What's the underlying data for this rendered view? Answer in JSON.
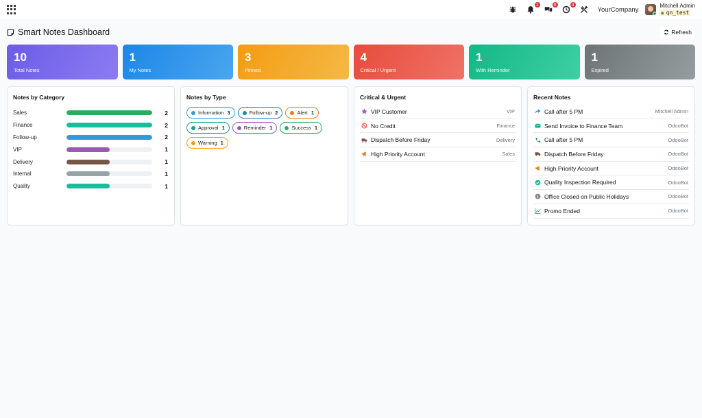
{
  "navbar": {
    "company": "YourCompany",
    "user_name": "Mitchell Admin",
    "db_name": "qn_test",
    "badges": {
      "activity": "1",
      "messages": "9",
      "clock": "4"
    }
  },
  "header": {
    "title": "Smart Notes Dashboard",
    "refresh_label": "Refresh"
  },
  "stats": [
    {
      "value": "10",
      "label": "Total Notes",
      "gradient": [
        "#6c5ce7",
        "#8b7cf2"
      ]
    },
    {
      "value": "1",
      "label": "My Notes",
      "gradient": [
        "#1c86e8",
        "#4aa6ee"
      ]
    },
    {
      "value": "3",
      "label": "Pinned",
      "gradient": [
        "#f39c12",
        "#f5b945"
      ]
    },
    {
      "value": "4",
      "label": "Critical / Urgent",
      "gradient": [
        "#e74c3c",
        "#ef7266"
      ]
    },
    {
      "value": "1",
      "label": "With Reminder",
      "gradient": [
        "#12b886",
        "#3fcfa5"
      ]
    },
    {
      "value": "1",
      "label": "Expired",
      "gradient": [
        "#6c7476",
        "#959d9e"
      ]
    }
  ],
  "category_panel": {
    "title": "Notes by Category",
    "max": 2,
    "items": [
      {
        "name": "Sales",
        "count": "2",
        "value": 2,
        "color": "#27ae60"
      },
      {
        "name": "Finance",
        "count": "2",
        "value": 2,
        "color": "#1abc9c"
      },
      {
        "name": "Follow-up",
        "count": "2",
        "value": 2,
        "color": "#3498db"
      },
      {
        "name": "VIP",
        "count": "1",
        "value": 1,
        "color": "#9b59b6"
      },
      {
        "name": "Delivery",
        "count": "1",
        "value": 1,
        "color": "#795548"
      },
      {
        "name": "Internal",
        "count": "1",
        "value": 1,
        "color": "#95a5a6"
      },
      {
        "name": "Quality",
        "count": "1",
        "value": 1,
        "color": "#1abc9c"
      }
    ]
  },
  "type_panel": {
    "title": "Notes by Type",
    "items": [
      {
        "name": "Information",
        "count": "3",
        "color": "#3498db"
      },
      {
        "name": "Follow-up",
        "count": "2",
        "color": "#2980b9"
      },
      {
        "name": "Alert",
        "count": "1",
        "color": "#e67e22"
      },
      {
        "name": "Approval",
        "count": "1",
        "color": "#16a085"
      },
      {
        "name": "Reminder",
        "count": "1",
        "color": "#9b59b6"
      },
      {
        "name": "Success",
        "count": "1",
        "color": "#27ae60"
      },
      {
        "name": "Warning",
        "count": "1",
        "color": "#f39c12"
      }
    ]
  },
  "critical_panel": {
    "title": "Critical & Urgent",
    "items": [
      {
        "icon": "star-icon",
        "title": "VIP Customer",
        "tag": "VIP",
        "color": "#9b59b6"
      },
      {
        "icon": "ban-icon",
        "title": "No Credit",
        "tag": "Finance",
        "color": "#e74c3c"
      },
      {
        "icon": "truck-icon",
        "title": "Dispatch Before Friday",
        "tag": "Delivery",
        "color": "#795548"
      },
      {
        "icon": "bullhorn-icon",
        "title": "High Priority Account",
        "tag": "Sales",
        "color": "#e67e22"
      }
    ]
  },
  "recent_panel": {
    "title": "Recent Notes",
    "items": [
      {
        "icon": "share-icon",
        "title": "Call after 5 PM",
        "author": "Mitchell Admin",
        "color": "#3498db"
      },
      {
        "icon": "envelope-icon",
        "title": "Send Invoice to Finance Team",
        "author": "OdooBot",
        "color": "#16a085"
      },
      {
        "icon": "phone-icon",
        "title": "Call after 5 PM",
        "author": "OdooBot",
        "color": "#2980b9"
      },
      {
        "icon": "truck-icon",
        "title": "Dispatch Before Friday",
        "author": "OdooBot",
        "color": "#795548"
      },
      {
        "icon": "bullhorn-icon",
        "title": "High Priority Account",
        "author": "OdooBot",
        "color": "#e67e22"
      },
      {
        "icon": "check-circle-icon",
        "title": "Quality Inspection Required",
        "author": "OdooBot",
        "color": "#1abc9c"
      },
      {
        "icon": "info-icon",
        "title": "Office Closed on Public Holidays",
        "author": "OdooBot",
        "color": "#7f8c8d"
      },
      {
        "icon": "chart-line-icon",
        "title": "Promo Ended",
        "author": "OdooBot",
        "color": "#27ae60"
      }
    ]
  }
}
